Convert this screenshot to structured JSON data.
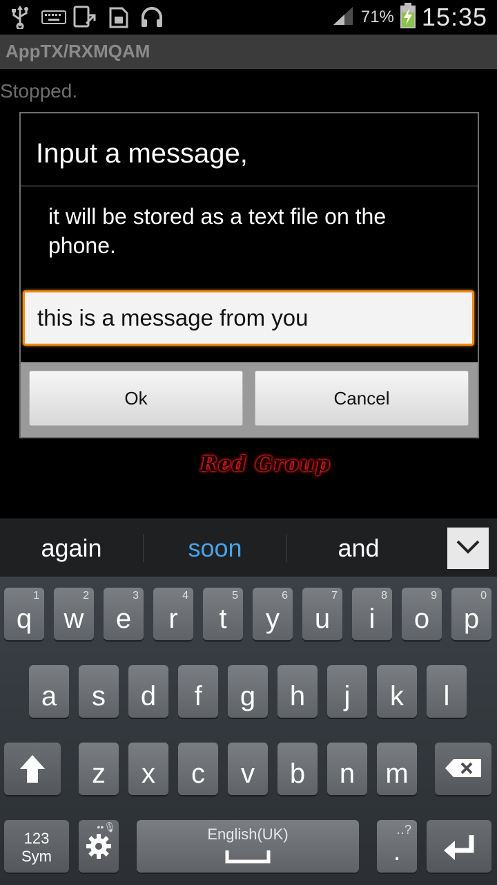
{
  "status_bar": {
    "icons": [
      "usb-icon",
      "keyboard-icon",
      "screen-capture-icon",
      "sd-card-icon",
      "headset-icon"
    ],
    "signal_icon": "signal-icon",
    "battery_percent": "71%",
    "battery_icon": "battery-charging-icon",
    "time": "15:35"
  },
  "app": {
    "title": "AppTX/RXMQAM",
    "status": "Stopped."
  },
  "dialog": {
    "title": "Input a message,",
    "message": "it will be stored as a text file on the phone.",
    "input_value": "this is a message from you",
    "ok_label": "Ok",
    "cancel_label": "Cancel"
  },
  "overlay_text": "Red Group",
  "suggestions": {
    "words": [
      "again",
      "soon",
      "and"
    ],
    "highlight_color": "#4aa3e8",
    "collapse_icon": "chevron-down-icon"
  },
  "keyboard": {
    "row1": [
      {
        "ch": "q",
        "num": "1"
      },
      {
        "ch": "w",
        "num": "2"
      },
      {
        "ch": "e",
        "num": "3"
      },
      {
        "ch": "r",
        "num": "4"
      },
      {
        "ch": "t",
        "num": "5"
      },
      {
        "ch": "y",
        "num": "6"
      },
      {
        "ch": "u",
        "num": "7"
      },
      {
        "ch": "i",
        "num": "8"
      },
      {
        "ch": "o",
        "num": "9"
      },
      {
        "ch": "p",
        "num": "0"
      }
    ],
    "row2": [
      "a",
      "s",
      "d",
      "f",
      "g",
      "h",
      "j",
      "k",
      "l"
    ],
    "row3": [
      "z",
      "x",
      "c",
      "v",
      "b",
      "n",
      "m"
    ],
    "sym_label_top": "123",
    "sym_label_bottom": "Sym",
    "space_label": "English(UK)",
    "period_label": ".",
    "period_hint": "‥?",
    "shift_icon": "shift-arrow-icon",
    "backspace_icon": "backspace-icon",
    "settings_icon": "gear-icon",
    "enter_icon": "enter-icon"
  }
}
